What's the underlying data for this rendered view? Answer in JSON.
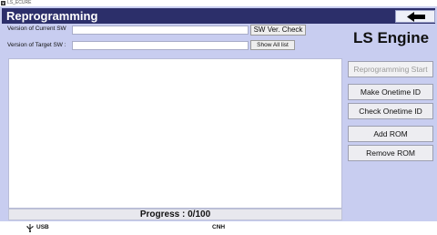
{
  "window": {
    "titlebar_text": "LS_ECURE",
    "header_title": "Reprogramming"
  },
  "versions": {
    "current_label": "Version of Current SW",
    "current_value": "",
    "target_label": "Version of Target SW :",
    "target_value": "",
    "check_button": "SW Ver. Check",
    "show_all_button": "Show All list"
  },
  "engine_label": "LS Engine",
  "actions": {
    "reprogramming_start": "Reprogramming Start",
    "make_onetime_id": "Make Onetime ID",
    "check_onetime_id": "Check Onetime ID",
    "add_rom": "Add ROM",
    "remove_rom": "Remove ROM"
  },
  "progress": {
    "text": "Progress : 0/100",
    "value": 0,
    "max": 100
  },
  "status": {
    "interface": "USB",
    "brand": "CNH"
  },
  "colors": {
    "header_bg": "#2c2f6a",
    "window_bg": "#c8cdf0"
  }
}
